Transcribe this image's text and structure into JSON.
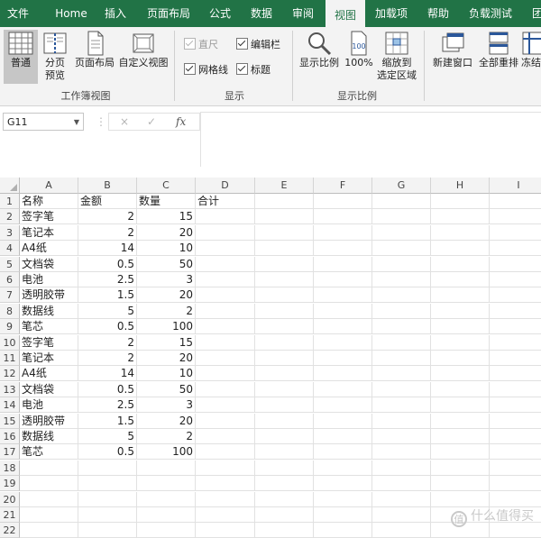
{
  "ribbon_tabs": [
    "文件",
    "Home",
    "插入",
    "页面布局",
    "公式",
    "数据",
    "审阅",
    "视图",
    "加载项",
    "帮助",
    "负载测试",
    "团队"
  ],
  "active_tab": "视图",
  "ribbon": {
    "workbook_views": {
      "normal": "普通",
      "page_break_line1": "分页",
      "page_break_line2": "预览",
      "page_layout": "页面布局",
      "custom_views": "自定义视图",
      "group_label": "工作簿视图"
    },
    "show": {
      "ruler": "直尺",
      "gridlines": "网格线",
      "formula_bar": "编辑栏",
      "headings": "标题",
      "group_label": "显示"
    },
    "zoom": {
      "zoom": "显示比例",
      "hundred": "100%",
      "zoom_sel_line1": "缩放到",
      "zoom_sel_line2": "选定区域",
      "group_label": "显示比例"
    },
    "window": {
      "new_window": "新建窗口",
      "arrange_all": "全部重排",
      "freeze": "冻结"
    }
  },
  "formula_bar": {
    "name_box": "G11",
    "cancel_symbol": "×",
    "enter_symbol": "✓",
    "fx_symbol": "fx",
    "content": ""
  },
  "columns": [
    "A",
    "B",
    "C",
    "D",
    "E",
    "F",
    "G",
    "H",
    "I"
  ],
  "rows": [
    {
      "num": "1",
      "a": "名称",
      "b": "金额",
      "c": "数量",
      "d": "合计"
    },
    {
      "num": "2",
      "a": "签字笔",
      "b": "2",
      "c": "15",
      "d": ""
    },
    {
      "num": "3",
      "a": "笔记本",
      "b": "2",
      "c": "20",
      "d": ""
    },
    {
      "num": "4",
      "a": "A4纸",
      "b": "14",
      "c": "10",
      "d": ""
    },
    {
      "num": "5",
      "a": "文档袋",
      "b": "0.5",
      "c": "50",
      "d": ""
    },
    {
      "num": "6",
      "a": "电池",
      "b": "2.5",
      "c": "3",
      "d": ""
    },
    {
      "num": "7",
      "a": "透明胶带",
      "b": "1.5",
      "c": "20",
      "d": ""
    },
    {
      "num": "8",
      "a": "数据线",
      "b": "5",
      "c": "2",
      "d": ""
    },
    {
      "num": "9",
      "a": "笔芯",
      "b": "0.5",
      "c": "100",
      "d": ""
    },
    {
      "num": "10",
      "a": "签字笔",
      "b": "2",
      "c": "15",
      "d": ""
    },
    {
      "num": "11",
      "a": "笔记本",
      "b": "2",
      "c": "20",
      "d": ""
    },
    {
      "num": "12",
      "a": "A4纸",
      "b": "14",
      "c": "10",
      "d": ""
    },
    {
      "num": "13",
      "a": "文档袋",
      "b": "0.5",
      "c": "50",
      "d": ""
    },
    {
      "num": "14",
      "a": "电池",
      "b": "2.5",
      "c": "3",
      "d": ""
    },
    {
      "num": "15",
      "a": "透明胶带",
      "b": "1.5",
      "c": "20",
      "d": ""
    },
    {
      "num": "16",
      "a": "数据线",
      "b": "5",
      "c": "2",
      "d": ""
    },
    {
      "num": "17",
      "a": "笔芯",
      "b": "0.5",
      "c": "100",
      "d": ""
    },
    {
      "num": "18",
      "a": "",
      "b": "",
      "c": "",
      "d": ""
    },
    {
      "num": "19",
      "a": "",
      "b": "",
      "c": "",
      "d": ""
    },
    {
      "num": "20",
      "a": "",
      "b": "",
      "c": "",
      "d": ""
    },
    {
      "num": "21",
      "a": "",
      "b": "",
      "c": "",
      "d": ""
    },
    {
      "num": "22",
      "a": "",
      "b": "",
      "c": "",
      "d": ""
    }
  ],
  "watermark": "什么值得买",
  "watermark_icon": "值",
  "colors": {
    "ribbon_green": "#217346",
    "ribbon_bg": "#f3f3f3"
  }
}
